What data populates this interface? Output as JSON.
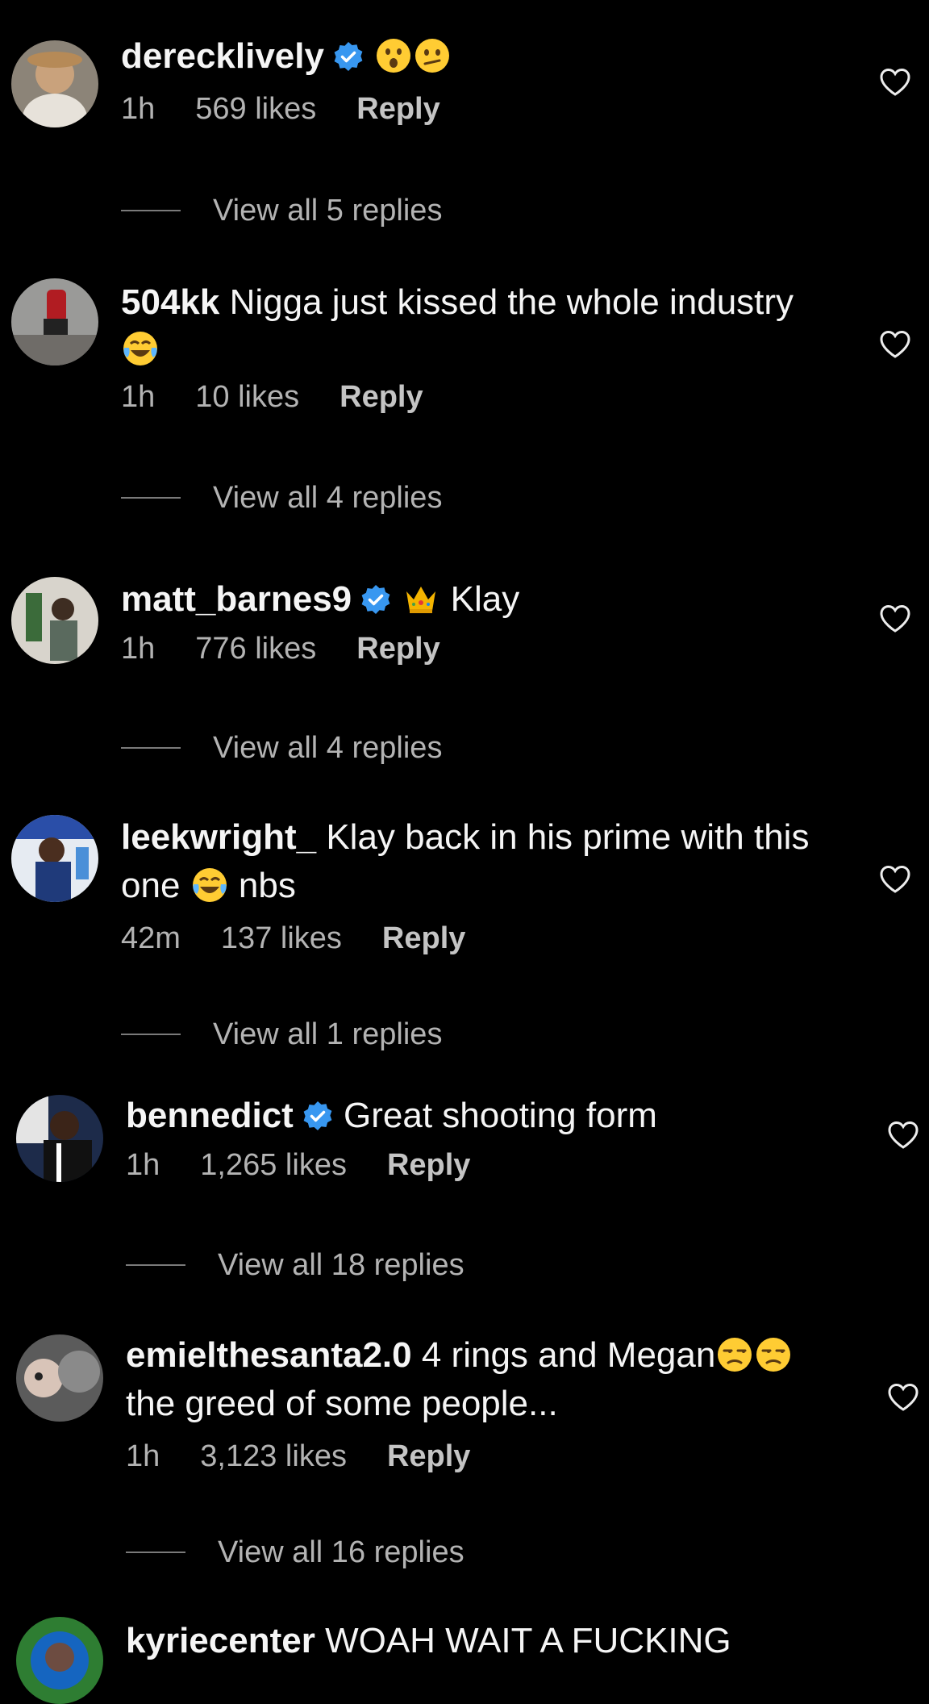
{
  "comments": [
    {
      "username": "derecklively",
      "verified": true,
      "text_lines": [
        ""
      ],
      "emojis_line1": [
        "astonished-face",
        "face-with-diagonal-mouth"
      ],
      "time": "1h",
      "likes": "569 likes",
      "reply": "Reply",
      "view_replies": "View all 5 replies"
    },
    {
      "username": "504kk",
      "verified": false,
      "line1": "Nigga just kissed the whole industry",
      "line2": "",
      "emojis_line2": [
        "face-with-tears-of-joy"
      ],
      "time": "1h",
      "likes": "10 likes",
      "reply": "Reply",
      "view_replies": "View all 4 replies"
    },
    {
      "username": "matt_barnes9",
      "verified": true,
      "emojis_line1": [
        "crown"
      ],
      "line1": "Klay",
      "time": "1h",
      "likes": "776 likes",
      "reply": "Reply",
      "view_replies": "View all 4 replies"
    },
    {
      "username": "leekwright_",
      "verified": false,
      "line1": "Klay back in his prime with this",
      "line2_before": "one",
      "emojis_line2": [
        "face-with-tears-of-joy"
      ],
      "line2_after": "nbs",
      "time": "42m",
      "likes": "137 likes",
      "reply": "Reply",
      "view_replies": "View all 1 replies"
    },
    {
      "username": "bennedict",
      "verified": true,
      "line1": "Great shooting form",
      "time": "1h",
      "likes": "1,265 likes",
      "reply": "Reply",
      "view_replies": "View all 18 replies"
    },
    {
      "username": "emielthesanta2.0",
      "verified": false,
      "line1": "4 rings and Megan",
      "emojis_line1": [
        "unamused-face",
        "unamused-face"
      ],
      "line2": "the greed of some people...",
      "time": "1h",
      "likes": "3,123 likes",
      "reply": "Reply",
      "view_replies": "View all 16 replies"
    },
    {
      "username": "kyriecenter",
      "verified": false,
      "line1": "WOAH WAIT A FUCKING"
    }
  ],
  "icons": {
    "like": "heart-outline-icon",
    "verified": "verified-badge-icon"
  },
  "colors": {
    "background": "#000000",
    "verified_blue": "#3897f0",
    "meta_text": "#b3b3b3"
  }
}
